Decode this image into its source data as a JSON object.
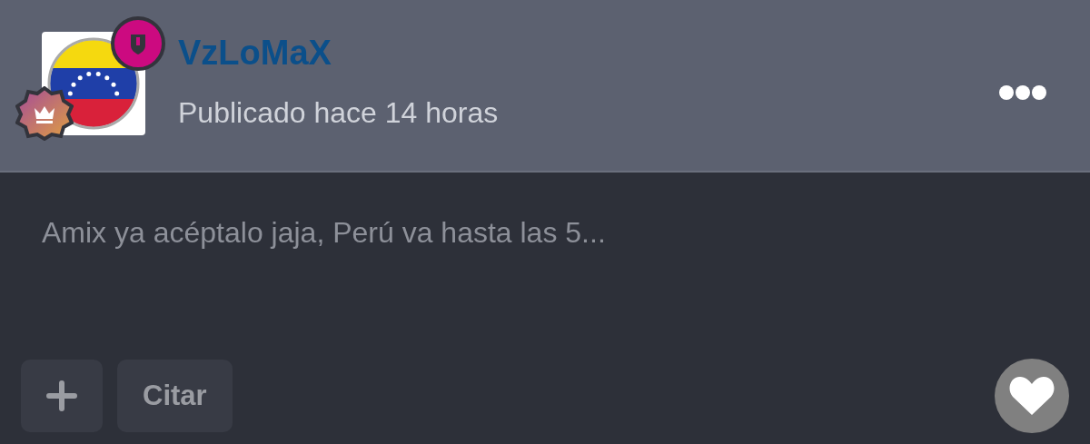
{
  "post": {
    "author": "VzLoMaX",
    "posted": "Publicado hace 14 horas",
    "body": "Amix ya acéptalo jaja, Perú va hasta las 5..."
  },
  "actions": [
    {
      "kind": "add"
    },
    {
      "kind": "text",
      "label": "Citar"
    }
  ]
}
